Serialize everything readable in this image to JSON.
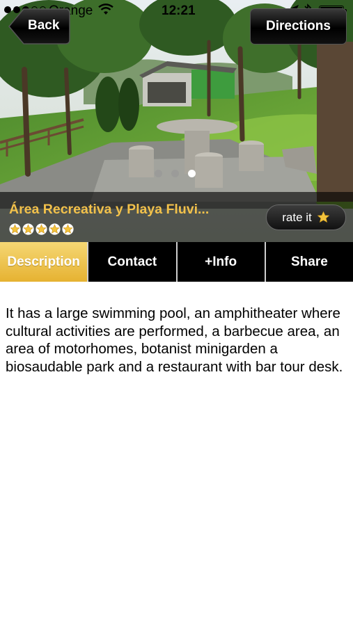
{
  "status_bar": {
    "carrier": "Orange",
    "time": "12:21"
  },
  "nav": {
    "back_label": "Back",
    "directions_label": "Directions"
  },
  "gallery": {
    "page_count": 3,
    "current_page": 3
  },
  "place": {
    "title": "Área Recreativa y Playa Fluvi...",
    "rating": 5,
    "rating_max": 5,
    "rate_label": "rate it"
  },
  "tabs": [
    {
      "label": "Description",
      "active": true
    },
    {
      "label": "Contact",
      "active": false
    },
    {
      "label": "+Info",
      "active": false
    },
    {
      "label": "Share",
      "active": false
    }
  ],
  "description": "It has a large swimming pool, an amphitheater where cultural activities are performed, a barbecue area, an area of motorhomes, botanist minigarden a biosaudable park and a restaurant with bar tour desk.",
  "colors": {
    "title_gold": "#f2c14b",
    "tab_active_top": "#f5d774",
    "tab_active_bottom": "#e6b231",
    "star": "#f3c33c"
  },
  "icons": [
    "wifi-icon",
    "location-arrow-icon",
    "bluetooth-icon",
    "battery-icon",
    "star-icon"
  ]
}
